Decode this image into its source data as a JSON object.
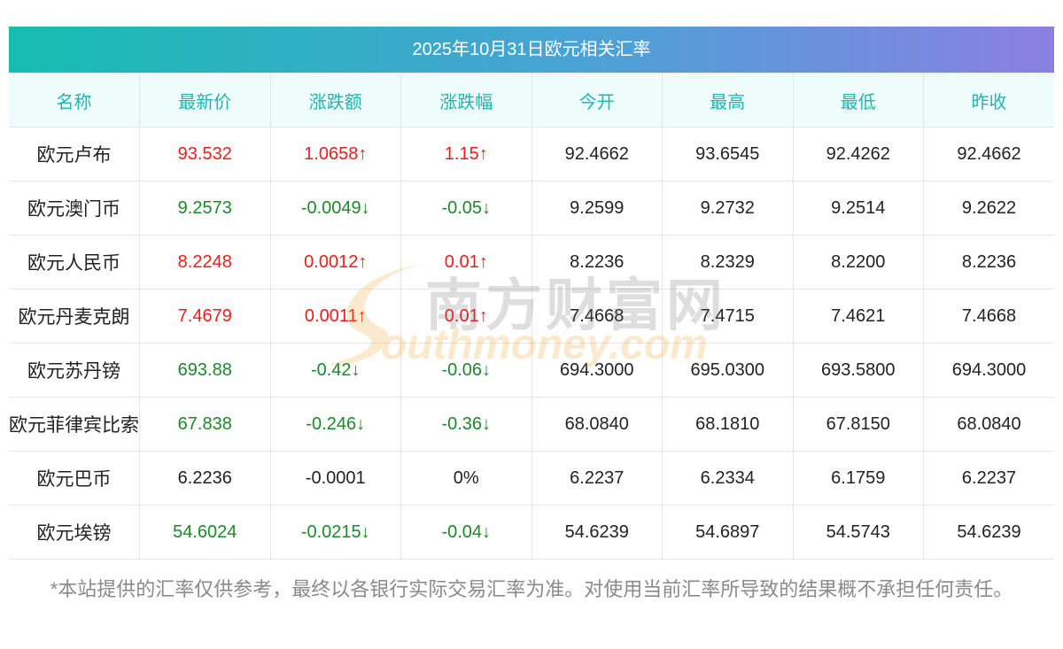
{
  "title": "2025年10月31日欧元相关汇率",
  "columns": [
    "名称",
    "最新价",
    "涨跌额",
    "涨跌幅",
    "今开",
    "最高",
    "最低",
    "昨收"
  ],
  "rows": [
    {
      "name": "欧元卢布",
      "latest": "93.532",
      "change": "1.0658↑",
      "pct": "1.15↑",
      "open": "92.4662",
      "high": "93.6545",
      "low": "92.4262",
      "prev": "92.4662",
      "trend": "up"
    },
    {
      "name": "欧元澳门币",
      "latest": "9.2573",
      "change": "-0.0049↓",
      "pct": "-0.05↓",
      "open": "9.2599",
      "high": "9.2732",
      "low": "9.2514",
      "prev": "9.2622",
      "trend": "down"
    },
    {
      "name": "欧元人民币",
      "latest": "8.2248",
      "change": "0.0012↑",
      "pct": "0.01↑",
      "open": "8.2236",
      "high": "8.2329",
      "low": "8.2200",
      "prev": "8.2236",
      "trend": "up"
    },
    {
      "name": "欧元丹麦克朗",
      "latest": "7.4679",
      "change": "0.0011↑",
      "pct": "0.01↑",
      "open": "7.4668",
      "high": "7.4715",
      "low": "7.4621",
      "prev": "7.4668",
      "trend": "up"
    },
    {
      "name": "欧元苏丹镑",
      "latest": "693.88",
      "change": "-0.42↓",
      "pct": "-0.06↓",
      "open": "694.3000",
      "high": "695.0300",
      "low": "693.5800",
      "prev": "694.3000",
      "trend": "down"
    },
    {
      "name": "欧元菲律宾比索",
      "latest": "67.838",
      "change": "-0.246↓",
      "pct": "-0.36↓",
      "open": "68.0840",
      "high": "68.1810",
      "low": "67.8150",
      "prev": "68.0840",
      "trend": "down"
    },
    {
      "name": "欧元巴币",
      "latest": "6.2236",
      "change": "-0.0001",
      "pct": "0%",
      "open": "6.2237",
      "high": "6.2334",
      "low": "6.1759",
      "prev": "6.2237",
      "trend": "flat"
    },
    {
      "name": "欧元埃镑",
      "latest": "54.6024",
      "change": "-0.0215↓",
      "pct": "-0.04↓",
      "open": "54.6239",
      "high": "54.6897",
      "low": "54.5743",
      "prev": "54.6239",
      "trend": "down"
    }
  ],
  "note": "*本站提供的汇率仅供参考，最终以各银行实际交易汇率为准。对使用当前汇率所导致的结果概不承担任何责任。",
  "watermark": {
    "cn": "南方财富网",
    "en": "outhmoney.com"
  },
  "colors": {
    "up": "#f21b1b",
    "down": "#1c8a2a",
    "header_text": "#1fb5b0",
    "title_gradient_start": "#16bdb0",
    "title_gradient_end": "#8b80e2"
  }
}
